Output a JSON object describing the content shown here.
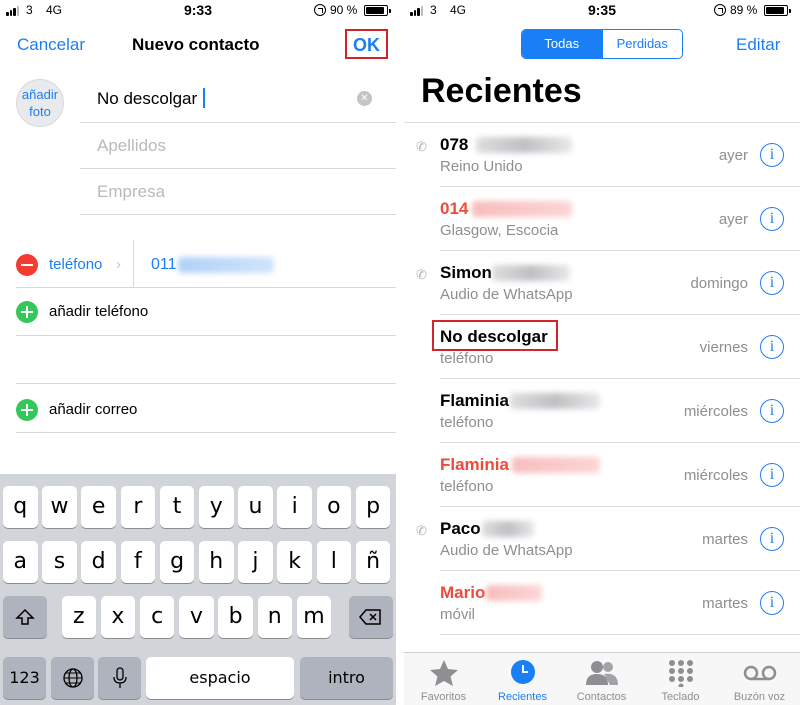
{
  "left": {
    "status": {
      "signal": "3",
      "network": "4G",
      "time": "9:33",
      "battery": "90 %",
      "battery_level": 0.9
    },
    "nav": {
      "cancel": "Cancelar",
      "title": "Nuevo contacto",
      "ok": "OK"
    },
    "photo": {
      "line1": "añadir",
      "line2": "foto"
    },
    "fields": {
      "first_name": "No descolgar",
      "last_name_placeholder": "Apellidos",
      "company_placeholder": "Empresa"
    },
    "phone": {
      "label": "teléfono",
      "value": "011"
    },
    "add_phone": "añadir teléfono",
    "add_email": "añadir correo",
    "keyboard": {
      "row1": [
        "q",
        "w",
        "e",
        "r",
        "t",
        "y",
        "u",
        "i",
        "o",
        "p"
      ],
      "row2": [
        "a",
        "s",
        "d",
        "f",
        "g",
        "h",
        "j",
        "k",
        "l",
        "ñ"
      ],
      "row3": [
        "z",
        "x",
        "c",
        "v",
        "b",
        "n",
        "m"
      ],
      "num": "123",
      "space": "espacio",
      "return": "intro"
    }
  },
  "right": {
    "status": {
      "signal": "3",
      "network": "4G",
      "time": "9:35",
      "battery": "89 %",
      "battery_level": 0.89
    },
    "segments": {
      "all": "Todas",
      "missed": "Perdidas"
    },
    "edit": "Editar",
    "title": "Recientes",
    "recents": [
      {
        "name": "078",
        "sub": "Reino Unido",
        "when": "ayer",
        "missed": false,
        "outgoing": true
      },
      {
        "name": "014",
        "sub": "Glasgow, Escocia",
        "when": "ayer",
        "missed": true,
        "outgoing": false
      },
      {
        "name": "Simon",
        "sub": "Audio de WhatsApp",
        "when": "domingo",
        "missed": false,
        "outgoing": true
      },
      {
        "name": "No descolgar",
        "sub": "teléfono",
        "when": "viernes",
        "missed": false,
        "outgoing": false
      },
      {
        "name": "Flaminia",
        "sub": "teléfono",
        "when": "miércoles",
        "missed": false,
        "outgoing": false
      },
      {
        "name": "Flaminia",
        "sub": "teléfono",
        "when": "miércoles",
        "missed": true,
        "outgoing": false
      },
      {
        "name": "Paco",
        "sub": "Audio de WhatsApp",
        "when": "martes",
        "missed": false,
        "outgoing": true
      },
      {
        "name": "Mario",
        "sub": "móvil",
        "when": "martes",
        "missed": true,
        "outgoing": false
      }
    ],
    "tabs": [
      "Favoritos",
      "Recientes",
      "Contactos",
      "Teclado",
      "Buzón voz"
    ]
  },
  "colors": {
    "accent": "#1a7ff5",
    "missed": "#f04a3b",
    "highlight": "#d2242b",
    "add": "#34c759",
    "remove": "#f33b30"
  }
}
